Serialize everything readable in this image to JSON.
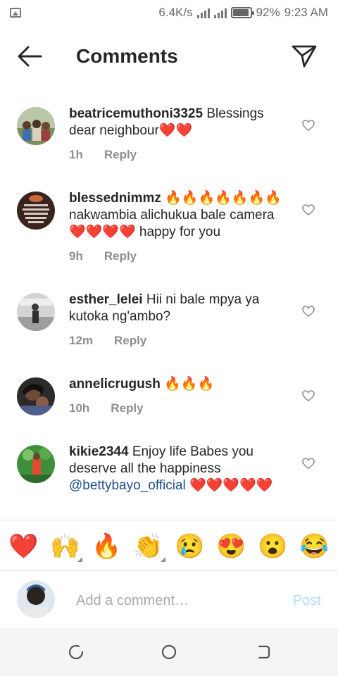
{
  "status_bar": {
    "speed": "6.4K/s",
    "battery_level": 0.92,
    "battery": "92%",
    "time": "9:23 AM"
  },
  "header": {
    "title": "Comments"
  },
  "comments": [
    {
      "username": "beatricemuthoni3325",
      "text": "Blessings dear neighbour❤️❤️",
      "time": "1h",
      "reply_label": "Reply"
    },
    {
      "username": "blessednimmz",
      "text": "🔥🔥🔥🔥🔥🔥🔥 nakwambia alichukua  bale camera ❤️❤️❤️❤️ happy for you",
      "time": "9h",
      "reply_label": "Reply"
    },
    {
      "username": "esther_lelei",
      "text": "Hii ni bale mpya ya kutoka ng'ambo?",
      "time": "12m",
      "reply_label": "Reply"
    },
    {
      "username": "annelicrugush",
      "text": "🔥🔥🔥",
      "time": "10h",
      "reply_label": "Reply"
    },
    {
      "username": "kikie2344",
      "text": "Enjoy life Babes you deserve all the happiness",
      "mention": "@bettybayo_official",
      "text_after": " ❤️❤️❤️❤️❤️"
    }
  ],
  "emoji_bar": [
    "❤️",
    "🙌",
    "🔥",
    "👏",
    "😢",
    "😍",
    "😮",
    "😂"
  ],
  "compose": {
    "placeholder": "Add a comment…",
    "post_label": "Post"
  },
  "colors": {
    "text": "#262626",
    "meta": "#8e8e8e",
    "mention": "#1f4e8a",
    "post_disabled": "#b3dbff"
  }
}
